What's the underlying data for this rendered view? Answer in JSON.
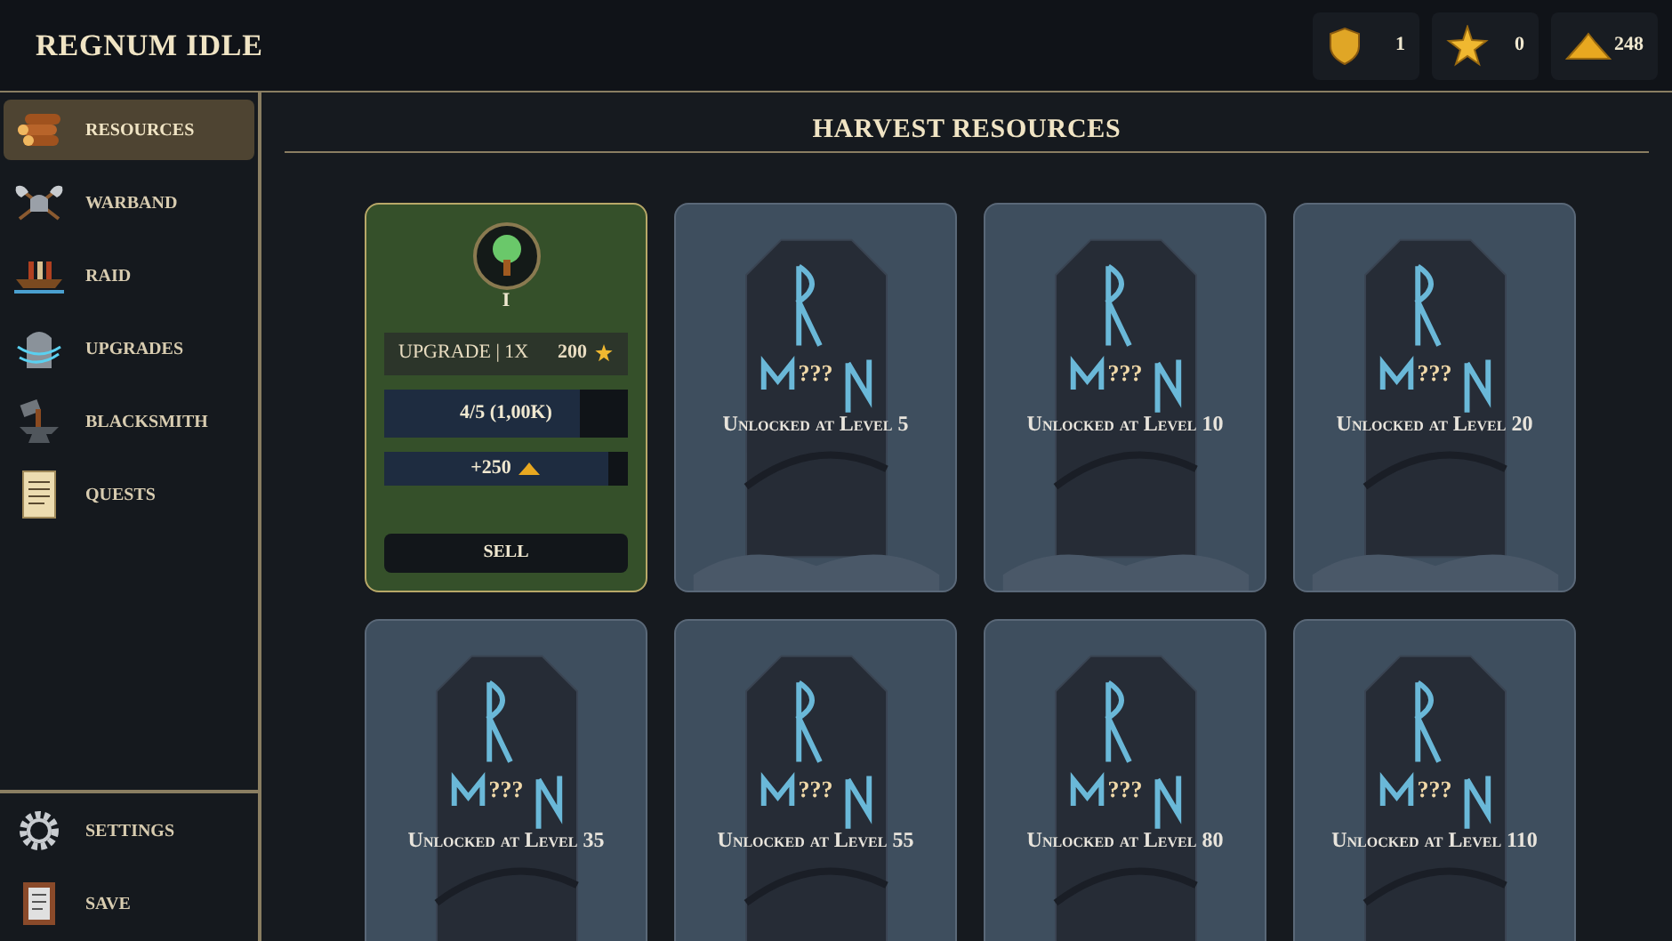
{
  "app": {
    "title": "REGNUM IDLE"
  },
  "currencies": [
    {
      "kind": "shield",
      "amount": "1"
    },
    {
      "kind": "star",
      "amount": "0"
    },
    {
      "kind": "gold",
      "amount": "248"
    }
  ],
  "sidebar": {
    "items": [
      {
        "label": "RESOURCES",
        "kind": "logs",
        "selected": true
      },
      {
        "label": "WARBAND",
        "kind": "axes",
        "selected": false
      },
      {
        "label": "RAID",
        "kind": "ship",
        "selected": false
      },
      {
        "label": "UPGRADES",
        "kind": "stone",
        "selected": false
      },
      {
        "label": "BLACKSMITH",
        "kind": "anvil",
        "selected": false
      },
      {
        "label": "QUESTS",
        "kind": "scroll",
        "selected": false
      }
    ],
    "bottom_items": [
      {
        "label": "SETTINGS",
        "kind": "gear"
      },
      {
        "label": "SAVE",
        "kind": "book"
      }
    ]
  },
  "main": {
    "title": "HARVEST RESOURCES",
    "cards": [
      {
        "kind": "unlocked",
        "level_badge": "I",
        "upgrade_label": "UPGRADE | 1X",
        "upgrade_cost": "200",
        "progress": {
          "text": "4/5 (1,00K)",
          "level": 0.8
        },
        "yield": {
          "text": "+250",
          "level": 0.92
        },
        "sell_label": "SELL"
      },
      {
        "kind": "locked",
        "question": "???",
        "text": "Unlocked at Level 5"
      },
      {
        "kind": "locked",
        "question": "???",
        "text": "Unlocked at Level 10"
      },
      {
        "kind": "locked",
        "question": "???",
        "text": "Unlocked at Level 20"
      },
      {
        "kind": "locked",
        "question": "???",
        "text": "Unlocked at Level 35"
      },
      {
        "kind": "locked",
        "question": "???",
        "text": "Unlocked at Level 55"
      },
      {
        "kind": "locked",
        "question": "???",
        "text": "Unlocked at Level 80"
      },
      {
        "kind": "locked",
        "question": "???",
        "text": "Unlocked at Level 110"
      }
    ]
  }
}
